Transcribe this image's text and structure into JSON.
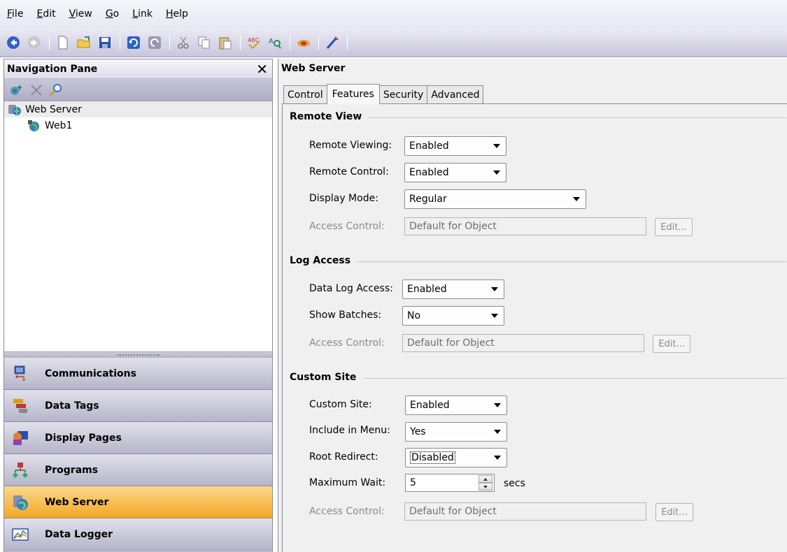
{
  "menu": [
    {
      "pre": "",
      "ul": "F",
      "post": "ile"
    },
    {
      "pre": "",
      "ul": "E",
      "post": "dit"
    },
    {
      "pre": "",
      "ul": "V",
      "post": "iew"
    },
    {
      "pre": "",
      "ul": "G",
      "post": "o"
    },
    {
      "pre": "",
      "ul": "L",
      "post": "ink"
    },
    {
      "pre": "",
      "ul": "H",
      "post": "elp"
    }
  ],
  "nav": {
    "title": "Navigation Pane",
    "tree": {
      "root": "Web Server",
      "child": "Web1"
    },
    "buttons": [
      {
        "label": "Communications"
      },
      {
        "label": "Data Tags"
      },
      {
        "label": "Display Pages"
      },
      {
        "label": "Programs"
      },
      {
        "label": "Web Server"
      },
      {
        "label": "Data Logger"
      }
    ],
    "active_button": "Web Server"
  },
  "right": {
    "title": "Web Server",
    "tabs": [
      "Control",
      "Features",
      "Security",
      "Advanced"
    ],
    "active_tab": "Features",
    "remote_view": {
      "title": "Remote View",
      "remote_viewing_label": "Remote Viewing:",
      "remote_viewing_value": "Enabled",
      "remote_control_label": "Remote Control:",
      "remote_control_value": "Enabled",
      "display_mode_label": "Display Mode:",
      "display_mode_value": "Regular",
      "access_control_label": "Access Control:",
      "access_control_value": "Default for Object",
      "edit_label": "Edit..."
    },
    "log_access": {
      "title": "Log Access",
      "data_log_access_label": "Data Log Access:",
      "data_log_access_value": "Enabled",
      "show_batches_label": "Show Batches:",
      "show_batches_value": "No",
      "access_control_label": "Access Control:",
      "access_control_value": "Default for Object",
      "edit_label": "Edit..."
    },
    "custom_site": {
      "title": "Custom Site",
      "custom_site_label": "Custom Site:",
      "custom_site_value": "Enabled",
      "include_in_menu_label": "Include in Menu:",
      "include_in_menu_value": "Yes",
      "root_redirect_label": "Root Redirect:",
      "root_redirect_value": "Disabled",
      "maximum_wait_label": "Maximum Wait:",
      "maximum_wait_value": "5",
      "maximum_wait_unit": "secs",
      "access_control_label": "Access Control:",
      "access_control_value": "Default for Object",
      "edit_label": "Edit..."
    }
  }
}
